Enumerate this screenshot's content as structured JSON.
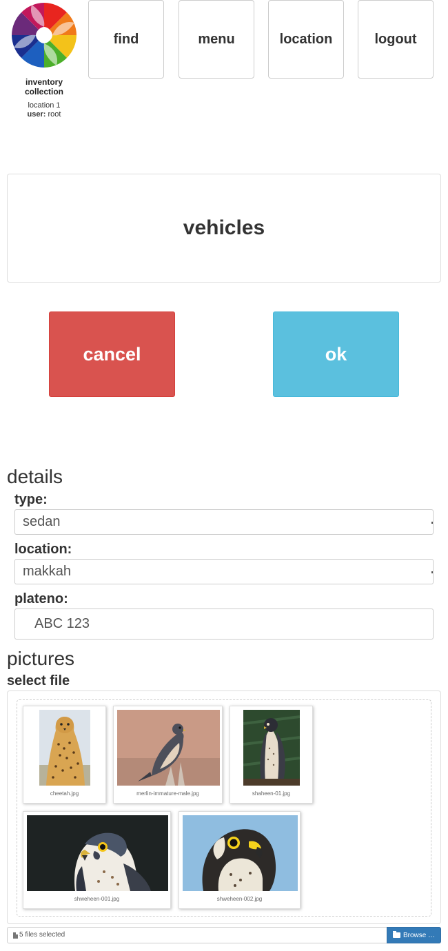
{
  "app": {
    "title": "inventory collection",
    "location": "location 1",
    "user_label": "user:",
    "user_value": "root"
  },
  "nav": {
    "find": "find",
    "menu": "menu",
    "location": "location",
    "logout": "logout"
  },
  "page": {
    "title": "vehicles"
  },
  "actions": {
    "cancel": "cancel",
    "ok": "ok",
    "cancel_color": "#d9534f",
    "ok_color": "#5bc0de"
  },
  "details": {
    "title": "details",
    "type_label": "type:",
    "type_value": "sedan",
    "location_label": "location:",
    "location_value": "makkah",
    "plateno_label": "plateno:",
    "plateno_value": "ABC 123"
  },
  "pictures": {
    "title": "pictures",
    "select_file_label": "select file",
    "files": [
      {
        "name": "cheetah.jpg",
        "subject": "cheetah"
      },
      {
        "name": "merlin-immature-male.jpg",
        "subject": "merlin falcon"
      },
      {
        "name": "shaheen-01.jpg",
        "subject": "peregrine falcon"
      },
      {
        "name": "shweheen-001.jpg",
        "subject": "falcon head"
      },
      {
        "name": "shweheen-002.jpg",
        "subject": "falcon head"
      }
    ],
    "files_selected": "5 files selected",
    "browse_label": "Browse …",
    "browse_color": "#337ab7"
  }
}
